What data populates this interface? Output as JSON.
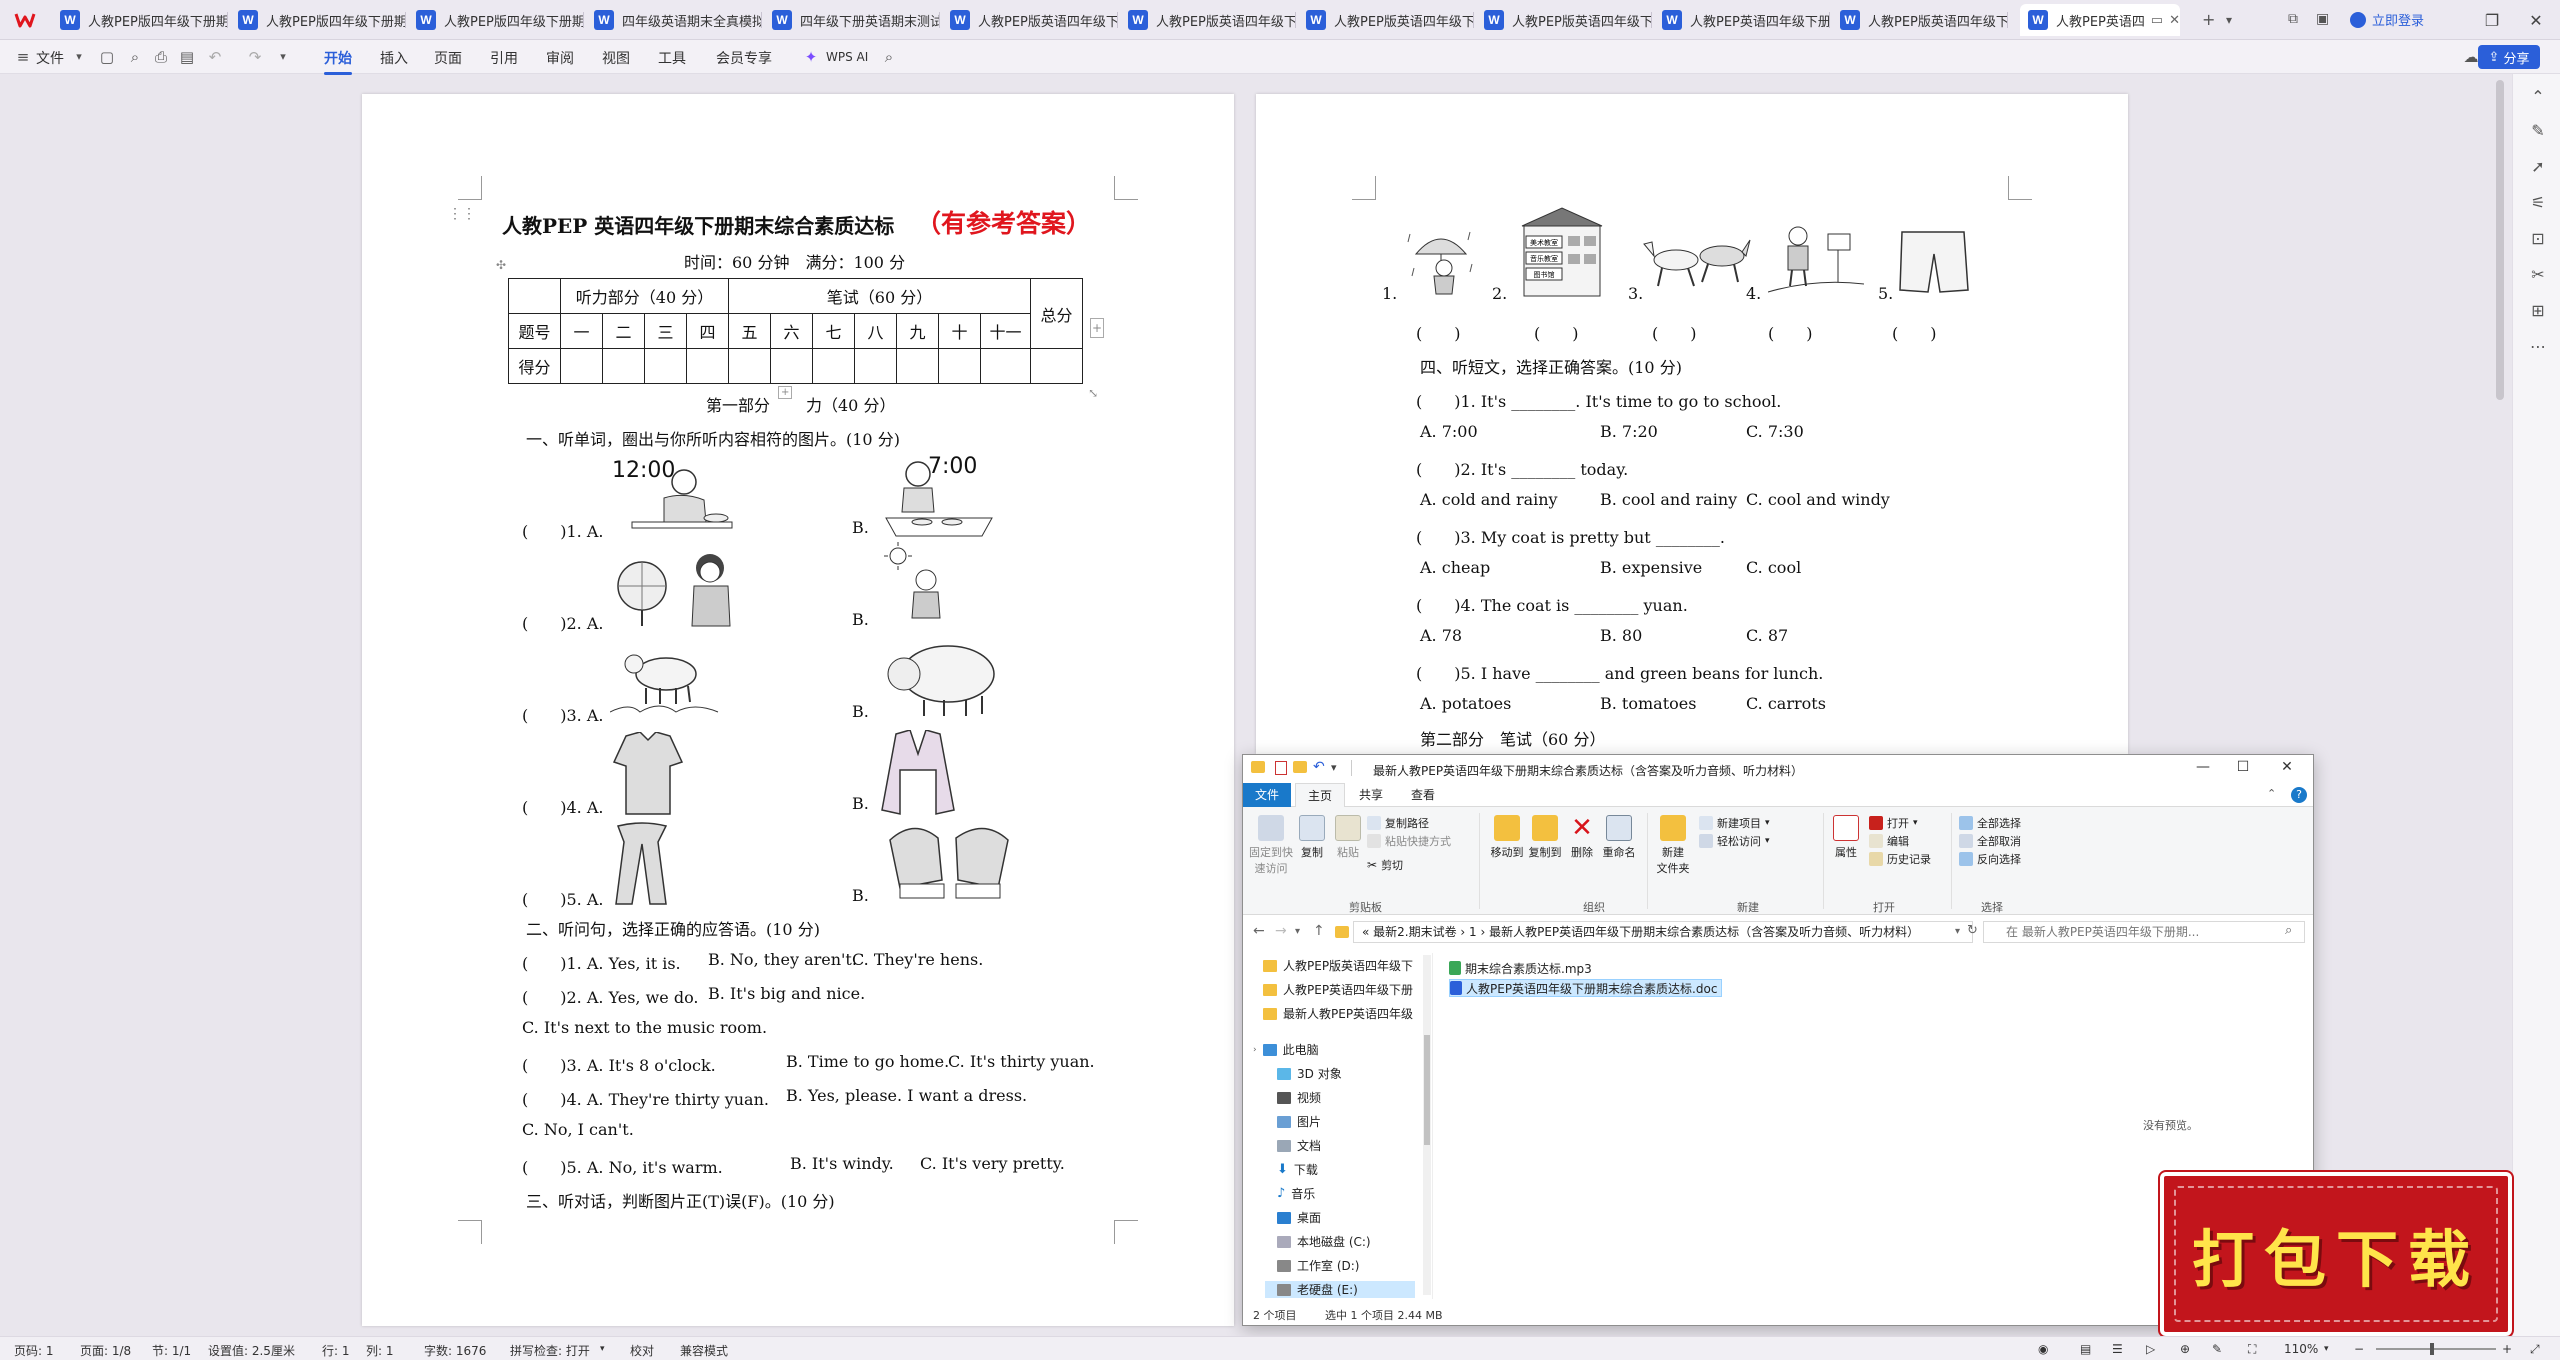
{
  "tabs": [
    {
      "label": "人教PEP版四年级下册期"
    },
    {
      "label": "人教PEP版四年级下册期"
    },
    {
      "label": "人教PEP版四年级下册期"
    },
    {
      "label": "四年级英语期末全真模拟"
    },
    {
      "label": "四年级下册英语期末测试"
    },
    {
      "label": "人教PEP版英语四年级下"
    },
    {
      "label": "人教PEP版英语四年级下"
    },
    {
      "label": "人教PEP版英语四年级下"
    },
    {
      "label": "人教PEP版英语四年级下"
    },
    {
      "label": "人教PEP英语四年级下册"
    },
    {
      "label": "人教PEP版英语四年级下"
    },
    {
      "label": "人教PEP英语四年"
    }
  ],
  "topbar": {
    "login": "立即登录",
    "share": "分享"
  },
  "ribbon": {
    "file_menu": "文件",
    "tabs": [
      "开始",
      "插入",
      "页面",
      "引用",
      "审阅",
      "视图",
      "工具",
      "会员专享"
    ],
    "wps_ai": "WPS AI"
  },
  "page1": {
    "title": "人教PEP 英语四年级下册期末综合素质达标",
    "title_red": "（有参考答案）",
    "subtitle": "时间：60 分钟　满分：100 分",
    "table": {
      "listening_header": "听力部分（40 分）",
      "written_header": "笔试（60 分）",
      "total_header": "总分",
      "row_label_num": "题号",
      "row_label_score": "得分",
      "numbers": [
        "一",
        "二",
        "三",
        "四",
        "五",
        "六",
        "七",
        "八",
        "九",
        "十",
        "十一"
      ]
    },
    "part1_heading_a": "第一部分",
    "part1_heading_b": "力（40 分）",
    "section1": "一、听单词，圈出与你所听内容相符的图片。(10 分)",
    "clock_a": "12:00",
    "clock_b": "7:00",
    "q1_items": [
      {
        "a": "(　　)1. A.",
        "b": "B."
      },
      {
        "a": "(　　)2. A.",
        "b": "B."
      },
      {
        "a": "(　　)3. A.",
        "b": "B."
      },
      {
        "a": "(　　)4. A.",
        "b": "B."
      },
      {
        "a": "(　　)5. A.",
        "b": "B."
      }
    ],
    "section2": "二、听问句，选择正确的应答语。(10 分)",
    "s2_lines": [
      {
        "q": "(　　)1. A. Yes, it is.",
        "b": "B. No, they aren't.",
        "c": "C. They're hens."
      },
      {
        "q": "(　　)2. A. Yes, we do.",
        "b": "B. It's big and nice.",
        "c": ""
      },
      {
        "q": "C. It's next to the music room.",
        "b": "",
        "c": ""
      },
      {
        "q": "(　　)3. A. It's 8 o'clock.",
        "b": "B. Time to go home.",
        "c": "C. It's thirty yuan."
      },
      {
        "q": "(　　)4. A. They're thirty yuan.",
        "b": "B. Yes, please. I want a dress.",
        "c": ""
      },
      {
        "q": "C. No, I can't.",
        "b": "",
        "c": ""
      },
      {
        "q": "(　　)5. A. No, it's warm.",
        "b": "B. It's windy.",
        "c": "C. It's very pretty."
      }
    ],
    "section3": "三、听对话，判断图片正(T)误(F)。(10 分)"
  },
  "page2": {
    "pic_numbers": [
      "1.",
      "2.",
      "3.",
      "4.",
      "5."
    ],
    "paren": "(　　)",
    "building_labels": [
      "美术教室",
      "音乐教室",
      "图书馆"
    ],
    "section4": "四、听短文，选择正确答案。(10 分)",
    "questions": [
      {
        "q": "(　　)1. It's ________. It's time to go to school.",
        "a": "A. 7:00",
        "b": "B. 7:20",
        "c": "C. 7:30"
      },
      {
        "q": "(　　)2. It's ________ today.",
        "a": "A. cold and rainy",
        "b": "B. cool and rainy",
        "c": "C. cool and windy"
      },
      {
        "q": "(　　)3. My coat is pretty but ________.",
        "a": "A. cheap",
        "b": "B. expensive",
        "c": "C. cool"
      },
      {
        "q": "(　　)4. The coat is ________ yuan.",
        "a": "A. 78",
        "b": "B. 80",
        "c": "C. 87"
      },
      {
        "q": "(　　)5. I have ________ and green beans for lunch.",
        "a": "A. potatoes",
        "b": "B. tomatoes",
        "c": "C. carrots"
      }
    ],
    "part2_heading": "第二部分　笔试（60 分）"
  },
  "explorer": {
    "title": "最新人教PEP英语四年级下册期末综合素质达标（含答案及听力音频、听力材料）",
    "tabs": [
      "文件",
      "主页",
      "共享",
      "查看"
    ],
    "groups": [
      "剪贴板",
      "组织",
      "新建",
      "打开",
      "选择"
    ],
    "buttons": {
      "pin": "固定到快\n速访问",
      "copy": "复制",
      "paste": "粘贴",
      "copy_path": "复制路径",
      "paste_shortcut": "粘贴快捷方式",
      "cut": "剪切",
      "move_to": "移动到",
      "copy_to": "复制到",
      "delete": "删除",
      "rename": "重命名",
      "new_folder": "新建\n文件夹",
      "new_item": "新建项目",
      "easy_access": "轻松访问",
      "properties": "属性",
      "open": "打开",
      "edit": "编辑",
      "history": "历史记录",
      "select_all": "全部选择",
      "select_none": "全部取消",
      "invert": "反向选择"
    },
    "address": "«  最新2.期末试卷  ›  1  ›  最新人教PEP英语四年级下册期末综合素质达标（含答案及听力音频、听力材料）",
    "search_placeholder": "在 最新人教PEP英语四年级下册期...",
    "nav": [
      {
        "label": "人教PEP版英语四年级下"
      },
      {
        "label": "人教PEP英语四年级下册"
      },
      {
        "label": "最新人教PEP英语四年级"
      },
      {
        "label": "此电脑"
      },
      {
        "label": "3D 对象"
      },
      {
        "label": "视频"
      },
      {
        "label": "图片"
      },
      {
        "label": "文档"
      },
      {
        "label": "下载"
      },
      {
        "label": "音乐"
      },
      {
        "label": "桌面"
      },
      {
        "label": "本地磁盘 (C:)"
      },
      {
        "label": "工作室 (D:)"
      },
      {
        "label": "老硬盘 (E:)"
      }
    ],
    "files": [
      {
        "name": "期末综合素质达标.mp3"
      },
      {
        "name": "人教PEP英语四年级下册期末综合素质达标.doc"
      }
    ],
    "preview": "没有预览。",
    "status_items": "2 个项目",
    "status_selected": "选中 1 个项目  2.44 MB"
  },
  "banner": {
    "text": "打包下载"
  },
  "statusbar": {
    "page_num": "页码: 1",
    "pages": "页面: 1/8",
    "section": "节: 1/1",
    "setting": "设置值: 2.5厘米",
    "row": "行: 1",
    "col": "列: 1",
    "words": "字数: 1676",
    "spell": "拼写检查: 打开",
    "proof": "校对",
    "compat": "兼容模式",
    "zoom": "110%"
  },
  "colors": {
    "accent": "#2b5fd9",
    "title_red": "#e0161e",
    "banner_red": "#c2151c",
    "banner_text": "#ffe44a"
  }
}
